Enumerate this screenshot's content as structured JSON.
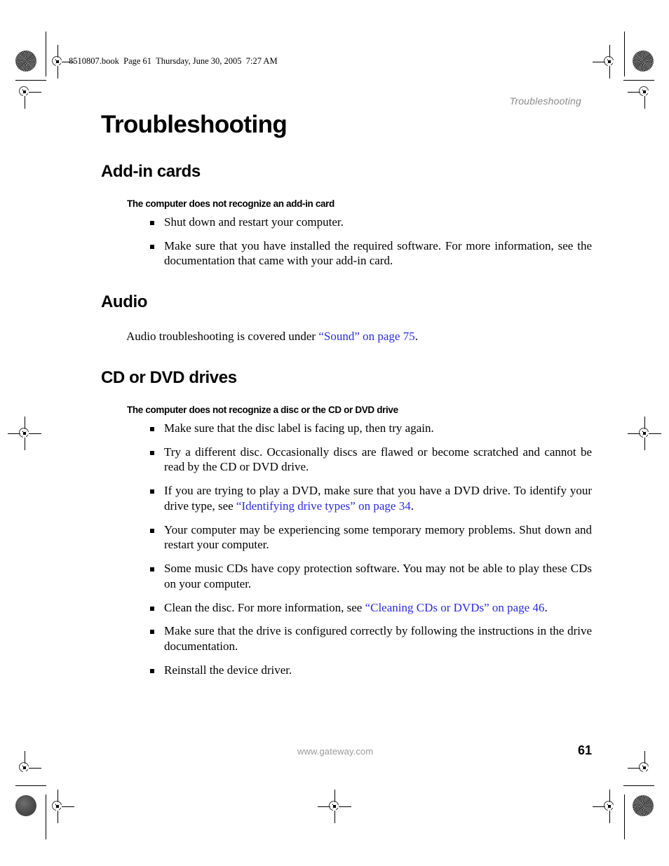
{
  "page": {
    "file_stamp": "8510807.book  Page 61  Thursday, June 30, 2005  7:27 AM",
    "running_head": "Troubleshooting",
    "chapter_title": "Troubleshooting",
    "footer_site": "www.gateway.com",
    "footer_page_number": "61",
    "link_color": "#2b2bdd",
    "running_head_color": "#8a8a8a",
    "footer_site_color": "#9a9a9a"
  },
  "sections": {
    "add_in_cards": {
      "heading": "Add-in cards",
      "subheading": "The computer does not recognize an add-in card",
      "bullets": [
        {
          "text": "Shut down and restart your computer."
        },
        {
          "text": "Make sure that you have installed the required software. For more information, see the documentation that came with your add-in card."
        }
      ]
    },
    "audio": {
      "heading": "Audio",
      "paragraph_before": "Audio troubleshooting is covered under ",
      "link_text": "“Sound” on page 75",
      "paragraph_after": "."
    },
    "cd_or_dvd_drives": {
      "heading": "CD or DVD drives",
      "subheading": "The computer does not recognize a disc or the CD or DVD drive",
      "bullets": [
        {
          "before": "Make sure that the disc label is facing up, then try again.",
          "link": "",
          "after": ""
        },
        {
          "before": "Try a different disc. Occasionally discs are flawed or become scratched and cannot be read by the CD or DVD drive.",
          "link": "",
          "after": ""
        },
        {
          "before": "If you are trying to play a DVD, make sure that you have a DVD drive. To identify your drive type, see ",
          "link": "“Identifying drive types” on page 34",
          "after": "."
        },
        {
          "before": "Your computer may be experiencing some temporary memory problems. Shut down and restart your computer.",
          "link": "",
          "after": ""
        },
        {
          "before": "Some music CDs have copy protection software. You may not be able to play these CDs on your computer.",
          "link": "",
          "after": ""
        },
        {
          "before": "Clean the disc. For more information, see ",
          "link": "“Cleaning CDs or DVDs” on page 46",
          "after": "."
        },
        {
          "before": "Make sure that the drive is configured correctly by following the instructions in the drive documentation.",
          "link": "",
          "after": ""
        },
        {
          "before": "Reinstall the device driver.",
          "link": "",
          "after": ""
        }
      ]
    }
  }
}
